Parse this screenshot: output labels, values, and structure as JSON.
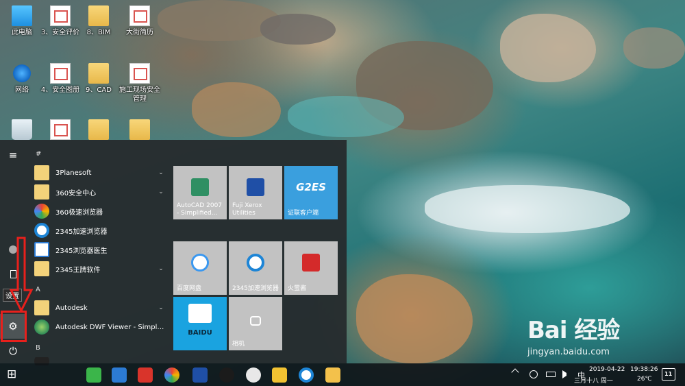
{
  "desktop": {
    "icons": [
      {
        "label": "此电脑",
        "kind": "pc"
      },
      {
        "label": "3、安全评价",
        "kind": "doc"
      },
      {
        "label": "8、BIM",
        "kind": "folder"
      },
      {
        "label": "大街简历",
        "kind": "doc"
      },
      {
        "label": "网络",
        "kind": "net"
      },
      {
        "label": "4、安全图册",
        "kind": "doc"
      },
      {
        "label": "9、CAD",
        "kind": "folder"
      },
      {
        "label": "施工现场安全管理",
        "kind": "doc"
      }
    ]
  },
  "start_menu": {
    "tooltip": "设置",
    "rail": {
      "menu_glyph": "≡",
      "settings_glyph": "⚙",
      "power_glyph": "⏻"
    },
    "letters": {
      "hash": "#",
      "a": "A",
      "b": "B"
    },
    "apps": [
      {
        "name": "3Planesoft",
        "expandable": true,
        "color": "#f3d27a"
      },
      {
        "name": "360安全中心",
        "expandable": true,
        "color": "#f3d27a"
      },
      {
        "name": "360极速浏览器",
        "expandable": false,
        "color": "#ffffff"
      },
      {
        "name": "2345加速浏览器",
        "expandable": false,
        "color": "#ffffff"
      },
      {
        "name": "2345浏览器医生",
        "expandable": false,
        "color": "#ffffff"
      },
      {
        "name": "2345王牌软件",
        "expandable": true,
        "color": "#f3d27a"
      },
      {
        "name": "Autodesk",
        "expandable": true,
        "color": "#f3d27a"
      },
      {
        "name": "Autodesk DWF Viewer - Simplifie...",
        "expandable": false,
        "color": "#ffffff"
      }
    ],
    "chevron": "⌄",
    "tiles": [
      {
        "label": "AutoCAD 2007 - Simplified...",
        "color": "#c2c2c2",
        "icon_color": "#2f8f63"
      },
      {
        "label": "Fuji Xerox Utilities",
        "color": "#c2c2c2",
        "icon_color": "#1f4fa6"
      },
      {
        "label": "证联客户端",
        "color": "#3a9fde",
        "icon_color": "#ffffff",
        "icon_text": "G2ES"
      },
      {
        "label": "百度网盘",
        "color": "#c2c2c2",
        "icon_color": "#3a98f0"
      },
      {
        "label": "2345加速浏览器",
        "color": "#c2c2c2",
        "icon_color": "#1d85d6"
      },
      {
        "label": "火萤酱",
        "color": "#c2c2c2",
        "icon_color": "#d42a2a"
      },
      {
        "label": "",
        "color": "#1aa3e0",
        "icon_color": "#ffffff",
        "icon_text": "BAIDU"
      },
      {
        "label": "相机",
        "color": "#c2c2c2",
        "icon_color": "#9a9a9a"
      }
    ]
  },
  "taskbar": {
    "start_glyph": "⊞",
    "apps": [
      {
        "name": "wechat",
        "color": "#3bb54a"
      },
      {
        "name": "network-app",
        "color": "#2c7bd4"
      },
      {
        "name": "fx-app",
        "color": "#d9342b"
      },
      {
        "name": "360-browser",
        "color": "#f0a020"
      },
      {
        "name": "fuji-xerox",
        "color": "#1f4fa6"
      },
      {
        "name": "qq",
        "color": "#1b1b1b"
      },
      {
        "name": "fox-app",
        "color": "#e8e8e8"
      },
      {
        "name": "sticky-app",
        "color": "#f1c232"
      },
      {
        "name": "ie-browser",
        "color": "#1d85d6"
      },
      {
        "name": "file-explorer",
        "color": "#f3c14b"
      }
    ],
    "tray": {
      "ime": "中",
      "date": "2019-04-22",
      "time": "19:38:26",
      "lunar": "三月十八 周一",
      "temp": "26℃",
      "notifications": "11"
    }
  },
  "watermark": {
    "brand": "Bai 经验",
    "url": "jingyan.baidu.com"
  }
}
